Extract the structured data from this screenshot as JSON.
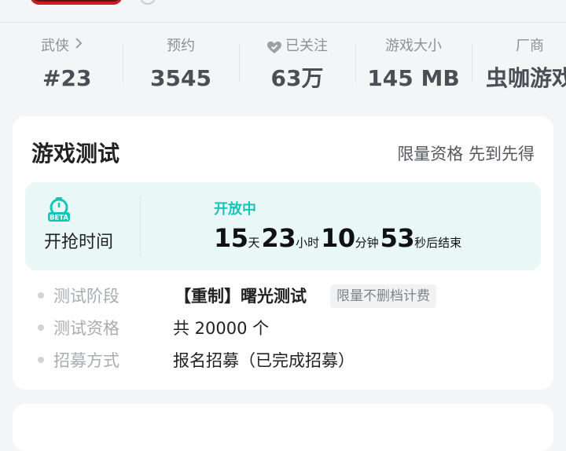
{
  "stats": [
    {
      "label": "武侠",
      "value": "#23",
      "icon": "chevron-right-icon"
    },
    {
      "label": "预约",
      "value": "3545"
    },
    {
      "label": "已关注",
      "value": "63万",
      "icon": "heart-check-icon"
    },
    {
      "label": "游戏大小",
      "value": "145 MB"
    },
    {
      "label": "厂商",
      "value": "虫咖游戏"
    }
  ],
  "test_card": {
    "title": "游戏测试",
    "subtitle": "限量资格 先到先得",
    "countdown": {
      "label": "开抢时间",
      "icon": "beta-timer-icon",
      "status": "开放中",
      "days": "15",
      "days_unit": "天",
      "hours": "23",
      "hours_unit": "小时",
      "minutes": "10",
      "minutes_unit": "分钟",
      "seconds": "53",
      "seconds_unit": "秒后结束"
    },
    "rows": [
      {
        "key": "测试阶段",
        "value": "【重制】曙光测试",
        "tag": "限量不删档计费"
      },
      {
        "key": "测试资格",
        "value": "共 20000 个"
      },
      {
        "key": "招募方式",
        "value": "报名招募（已完成招募）"
      }
    ]
  },
  "colors": {
    "accent_teal": "#15c5b6",
    "countdown_bg": "#e9f8f7",
    "page_bg": "#f3f5f6"
  }
}
